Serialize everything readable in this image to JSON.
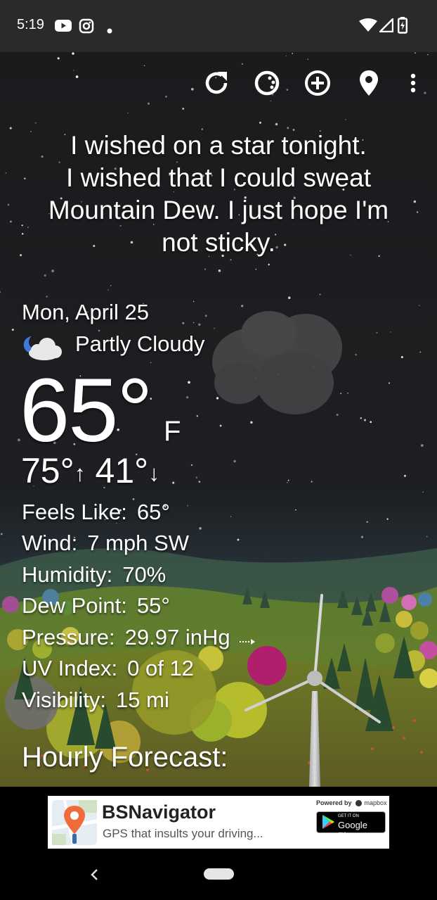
{
  "status_bar": {
    "time": "5:19",
    "left_icons": [
      "youtube-icon",
      "instagram-icon",
      "dot-icon"
    ],
    "right_icons": [
      "wifi-icon",
      "cell-signal-icon",
      "battery-charging-icon"
    ]
  },
  "toolbar": {
    "buttons": [
      "refresh-icon",
      "theme-icon",
      "add-icon",
      "location-pin-icon",
      "more-vert-icon"
    ]
  },
  "quote": {
    "lines": [
      "I wished on a star tonight.",
      "I wished that I could sweat",
      "Mountain Dew. I just hope I'm",
      "not sticky."
    ]
  },
  "weather": {
    "date": "Mon, April 25",
    "condition_icon": "partly-cloudy-night-icon",
    "condition": "Partly Cloudy",
    "temperature": "65°",
    "unit": "F",
    "high": "75°",
    "low": "41°",
    "high_arrow": "↑",
    "low_arrow": "↓",
    "details": [
      {
        "label": "Feels Like:",
        "value": "65°"
      },
      {
        "label": "Wind:",
        "value": "7 mph SW"
      },
      {
        "label": "Humidity:",
        "value": "70%"
      },
      {
        "label": "Dew Point:",
        "value": "55°"
      },
      {
        "label": "Pressure:",
        "value": "29.97 inHg"
      },
      {
        "label": "UV Index:",
        "value": "0 of 12"
      },
      {
        "label": "Visibility:",
        "value": "15 mi"
      }
    ],
    "pressure_trend_icon": "arrow-right-dotted-icon",
    "hourly_heading": "Hourly Forecast:"
  },
  "ad": {
    "title": "BSNavigator",
    "subtitle": "GPS that insults your driving...",
    "powered_by": "Powered by",
    "powered_brand": "mapbox",
    "store_small": "GET IT ON",
    "store_big": "Google Play"
  },
  "colors": {
    "status_bar_bg": "#2a2a2b",
    "sky": "#191a1c",
    "text": "#ffffff",
    "hill_green": "#5a7a2e",
    "ad_bg": "#ffffff"
  }
}
